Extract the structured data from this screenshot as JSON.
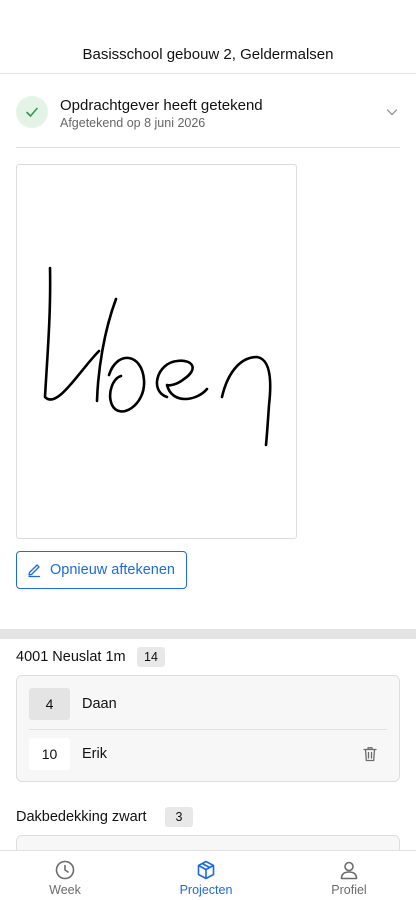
{
  "header": {
    "title": "Basisschool gebouw 2, Geldermalsen"
  },
  "signature": {
    "status_title": "Opdrachtgever heeft getekend",
    "status_subtitle": "Afgetekend op 8 juni 2026",
    "signature_text": "Koen",
    "resign_label": "Opnieuw aftekenen"
  },
  "sections": [
    {
      "name": "4001 Neuslat 1m",
      "count": "14",
      "rows": [
        {
          "qty": "4",
          "name": "Daan"
        },
        {
          "qty": "10",
          "name": "Erik"
        }
      ]
    },
    {
      "name": "Dakbedekking zwart",
      "count": "3"
    }
  ],
  "tabs": [
    {
      "label": "Week",
      "icon": "clock-icon"
    },
    {
      "label": "Projecten",
      "icon": "box-icon",
      "active": true
    },
    {
      "label": "Profiel",
      "icon": "user-icon"
    }
  ],
  "colors": {
    "accent": "#1d6ae5",
    "success_bg": "#e3f4e6",
    "success": "#2f9b47",
    "band": "#e4e4e4"
  }
}
